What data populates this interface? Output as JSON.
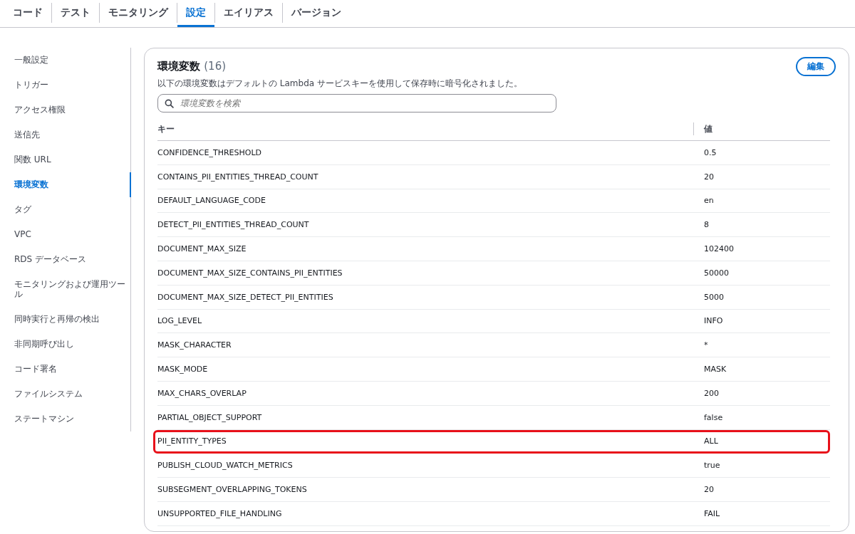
{
  "tabs": [
    {
      "label": "コード",
      "selected": false
    },
    {
      "label": "テスト",
      "selected": false
    },
    {
      "label": "モニタリング",
      "selected": false
    },
    {
      "label": "設定",
      "selected": true
    },
    {
      "label": "エイリアス",
      "selected": false
    },
    {
      "label": "バージョン",
      "selected": false
    }
  ],
  "sidebar": {
    "items": [
      {
        "label": "一般設定",
        "selected": false
      },
      {
        "label": "トリガー",
        "selected": false
      },
      {
        "label": "アクセス権限",
        "selected": false
      },
      {
        "label": "送信先",
        "selected": false
      },
      {
        "label": "関数 URL",
        "selected": false
      },
      {
        "label": "環境変数",
        "selected": true
      },
      {
        "label": "タグ",
        "selected": false
      },
      {
        "label": "VPC",
        "selected": false
      },
      {
        "label": "RDS データベース",
        "selected": false
      },
      {
        "label": "モニタリングおよび運用ツール",
        "selected": false
      },
      {
        "label": "同時実行と再帰の検出",
        "selected": false
      },
      {
        "label": "非同期呼び出し",
        "selected": false
      },
      {
        "label": "コード署名",
        "selected": false
      },
      {
        "label": "ファイルシステム",
        "selected": false
      },
      {
        "label": "ステートマシン",
        "selected": false
      }
    ]
  },
  "panel": {
    "title": "環境変数",
    "count": "(16)",
    "edit_button": "編集",
    "description": "以下の環境変数はデフォルトの Lambda サービスキーを使用して保存時に暗号化されました。",
    "search": {
      "placeholder": "環境変数を検索"
    }
  },
  "table": {
    "columns": [
      "キー",
      "値"
    ],
    "rows": [
      {
        "key": "CONFIDENCE_THRESHOLD",
        "value": "0.5",
        "highlighted": false
      },
      {
        "key": "CONTAINS_PII_ENTITIES_THREAD_COUNT",
        "value": "20",
        "highlighted": false
      },
      {
        "key": "DEFAULT_LANGUAGE_CODE",
        "value": "en",
        "highlighted": false
      },
      {
        "key": "DETECT_PII_ENTITIES_THREAD_COUNT",
        "value": "8",
        "highlighted": false
      },
      {
        "key": "DOCUMENT_MAX_SIZE",
        "value": "102400",
        "highlighted": false
      },
      {
        "key": "DOCUMENT_MAX_SIZE_CONTAINS_PII_ENTITIES",
        "value": "50000",
        "highlighted": false
      },
      {
        "key": "DOCUMENT_MAX_SIZE_DETECT_PII_ENTITIES",
        "value": "5000",
        "highlighted": false
      },
      {
        "key": "LOG_LEVEL",
        "value": "INFO",
        "highlighted": false
      },
      {
        "key": "MASK_CHARACTER",
        "value": "*",
        "highlighted": false
      },
      {
        "key": "MASK_MODE",
        "value": "MASK",
        "highlighted": false
      },
      {
        "key": "MAX_CHARS_OVERLAP",
        "value": "200",
        "highlighted": false
      },
      {
        "key": "PARTIAL_OBJECT_SUPPORT",
        "value": "false",
        "highlighted": false
      },
      {
        "key": "PII_ENTITY_TYPES",
        "value": "ALL",
        "highlighted": true
      },
      {
        "key": "PUBLISH_CLOUD_WATCH_METRICS",
        "value": "true",
        "highlighted": false
      },
      {
        "key": "SUBSEGMENT_OVERLAPPING_TOKENS",
        "value": "20",
        "highlighted": false
      },
      {
        "key": "UNSUPPORTED_FILE_HANDLING",
        "value": "FAIL",
        "highlighted": false
      }
    ]
  }
}
